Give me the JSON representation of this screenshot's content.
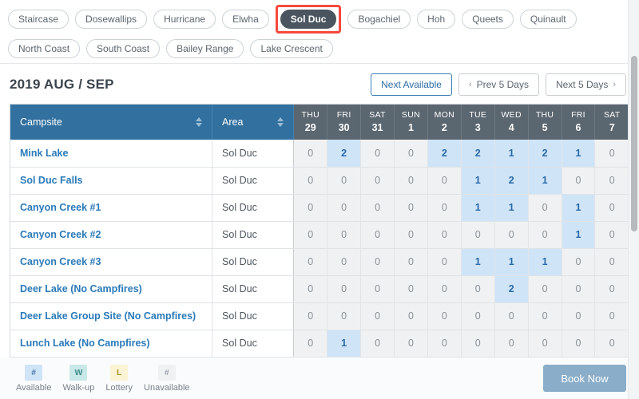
{
  "filters": {
    "rows": [
      [
        "Staircase",
        "Dosewallips",
        "Hurricane",
        "Elwha",
        "Sol Duc",
        "Bogachiel",
        "Hoh",
        "Queets",
        "Quinault"
      ],
      [
        "North Coast",
        "South Coast",
        "Bailey Range",
        "Lake Crescent"
      ]
    ],
    "selected": "Sol Duc",
    "highlight_color": "#f5493d",
    "selected_bg": "#4a555f"
  },
  "header": {
    "date_title": "2019 AUG / SEP",
    "next_available_label": "Next Available",
    "prev_label": "Prev 5 Days",
    "next_label": "Next 5 Days",
    "prev_chevron": "‹",
    "next_chevron": "›"
  },
  "table": {
    "col_campsite": "Campsite",
    "col_area": "Area",
    "dates": [
      {
        "dow": "THU",
        "num": "29"
      },
      {
        "dow": "FRI",
        "num": "30"
      },
      {
        "dow": "SAT",
        "num": "31"
      },
      {
        "dow": "SUN",
        "num": "1"
      },
      {
        "dow": "MON",
        "num": "2"
      },
      {
        "dow": "TUE",
        "num": "3"
      },
      {
        "dow": "WED",
        "num": "4"
      },
      {
        "dow": "THU",
        "num": "5"
      },
      {
        "dow": "FRI",
        "num": "6"
      },
      {
        "dow": "SAT",
        "num": "7"
      }
    ],
    "rows": [
      {
        "campsite": "Mink Lake",
        "area": "Sol Duc",
        "counts": [
          0,
          2,
          0,
          0,
          2,
          2,
          1,
          2,
          1,
          0
        ]
      },
      {
        "campsite": "Sol Duc Falls",
        "area": "Sol Duc",
        "counts": [
          0,
          0,
          0,
          0,
          0,
          1,
          2,
          1,
          0,
          0
        ]
      },
      {
        "campsite": "Canyon Creek #1",
        "area": "Sol Duc",
        "counts": [
          0,
          0,
          0,
          0,
          0,
          1,
          1,
          0,
          1,
          0
        ]
      },
      {
        "campsite": "Canyon Creek #2",
        "area": "Sol Duc",
        "counts": [
          0,
          0,
          0,
          0,
          0,
          0,
          0,
          0,
          1,
          0
        ]
      },
      {
        "campsite": "Canyon Creek #3",
        "area": "Sol Duc",
        "counts": [
          0,
          0,
          0,
          0,
          0,
          1,
          1,
          1,
          0,
          0
        ]
      },
      {
        "campsite": "Deer Lake (No Campfires)",
        "area": "Sol Duc",
        "counts": [
          0,
          0,
          0,
          0,
          0,
          0,
          2,
          0,
          0,
          0
        ]
      },
      {
        "campsite": "Deer Lake Group Site (No Campfires)",
        "area": "Sol Duc",
        "counts": [
          0,
          0,
          0,
          0,
          0,
          0,
          0,
          0,
          0,
          0
        ]
      },
      {
        "campsite": "Lunch Lake (No Campfires)",
        "area": "Sol Duc",
        "counts": [
          0,
          1,
          0,
          0,
          0,
          0,
          0,
          0,
          0,
          0
        ]
      }
    ]
  },
  "footer": {
    "legend": [
      {
        "glyph": "#",
        "label": "Available",
        "key": "available"
      },
      {
        "glyph": "W",
        "label": "Walk-up",
        "key": "walkup"
      },
      {
        "glyph": "L",
        "label": "Lottery",
        "key": "lottery"
      },
      {
        "glyph": "#",
        "label": "Unavailable",
        "key": "unavailable"
      }
    ],
    "book_label": "Book Now"
  }
}
